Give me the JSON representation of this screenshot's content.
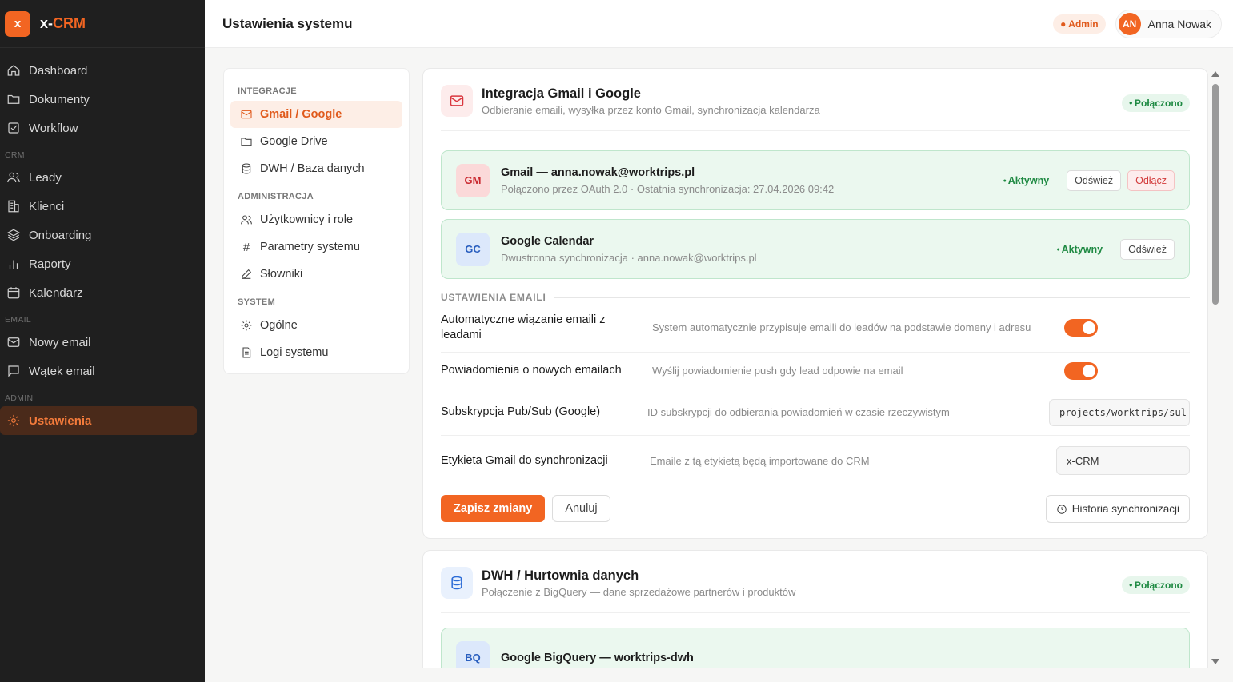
{
  "brand": {
    "logo_letter": "x",
    "name_prefix": "x-",
    "name_suffix": "CRM",
    "accent": "#f26522"
  },
  "sidebar": {
    "items": [
      {
        "label": "Dashboard",
        "icon": "home-icon"
      },
      {
        "label": "Dokumenty",
        "icon": "folder-icon"
      },
      {
        "label": "Workflow",
        "icon": "check-square-icon"
      }
    ],
    "crm_section": "CRM",
    "crm_items": [
      {
        "label": "Leady",
        "icon": "users-icon"
      },
      {
        "label": "Klienci",
        "icon": "building-icon"
      },
      {
        "label": "Onboarding",
        "icon": "layers-icon"
      },
      {
        "label": "Raporty",
        "icon": "bar-chart-icon"
      },
      {
        "label": "Kalendarz",
        "icon": "calendar-icon"
      }
    ],
    "email_section": "EMAIL",
    "email_items": [
      {
        "label": "Nowy email",
        "icon": "mail-icon"
      },
      {
        "label": "Wątek email",
        "icon": "message-icon"
      }
    ],
    "admin_section": "ADMIN",
    "admin_items": [
      {
        "label": "Ustawienia",
        "icon": "gear-icon",
        "active": true
      }
    ]
  },
  "header": {
    "title": "Ustawienia systemu",
    "role_badge": "● Admin",
    "user_initials": "AN",
    "user_name": "Anna Nowak"
  },
  "settings_nav": {
    "integrations_title": "INTEGRACJE",
    "integrations": [
      "Gmail / Google",
      "Google Drive",
      "DWH / Baza danych"
    ],
    "admin_title": "ADMINISTRACJA",
    "admin": [
      "Użytkownicy i role",
      "Parametry systemu",
      "Słowniki"
    ],
    "system_title": "SYSTEM",
    "system": [
      "Ogólne",
      "Logi systemu"
    ]
  },
  "gmail_card": {
    "title": "Integracja Gmail i Google",
    "subtitle": "Odbieranie emaili, wysyłka przez konto Gmail, synchronizacja kalendarza",
    "status": "Połączono",
    "accounts": [
      {
        "logo": "GM",
        "name": "Gmail — anna.nowak@worktrips.pl",
        "sub": "Połączono przez OAuth 2.0 · Ostatnia synchronizacja: 27.04.2026 09:42",
        "status": "Aktywny",
        "refresh": "Odśwież",
        "disconnect": "Odłącz"
      },
      {
        "logo": "GC",
        "name": "Google Calendar",
        "sub": "Dwustronna synchronizacja · anna.nowak@worktrips.pl",
        "status": "Aktywny",
        "refresh": "Odśwież"
      }
    ],
    "email_settings_title": "USTAWIENIA EMAILI",
    "settings": [
      {
        "label": "Automatyczne wiązanie emaili z leadami",
        "desc": "System automatycznie przypisuje emaili do leadów na podstawie domeny i adresu",
        "type": "toggle",
        "on": true
      },
      {
        "label": "Powiadomienia o nowych emailach",
        "desc": "Wyślij powiadomienie push gdy lead odpowie na email",
        "type": "toggle",
        "on": true
      },
      {
        "label": "Subskrypcja Pub/Sub (Google)",
        "desc": "ID subskrypcji do odbierania powiadomień w czasie rzeczywistym",
        "type": "input",
        "value": "projects/worktrips/sul"
      },
      {
        "label": "Etykieta Gmail do synchronizacji",
        "desc": "Emaile z tą etykietą będą importowane do CRM",
        "type": "input",
        "value": "x-CRM"
      }
    ],
    "save": "Zapisz zmiany",
    "cancel": "Anuluj",
    "history": "Historia synchronizacji"
  },
  "dwh_card": {
    "title": "DWH / Hurtownia danych",
    "subtitle": "Połączenie z BigQuery — dane sprzedażowe partnerów i produktów",
    "status": "Połączono",
    "account_logo": "BQ",
    "account_name": "Google BigQuery — worktrips-dwh"
  }
}
